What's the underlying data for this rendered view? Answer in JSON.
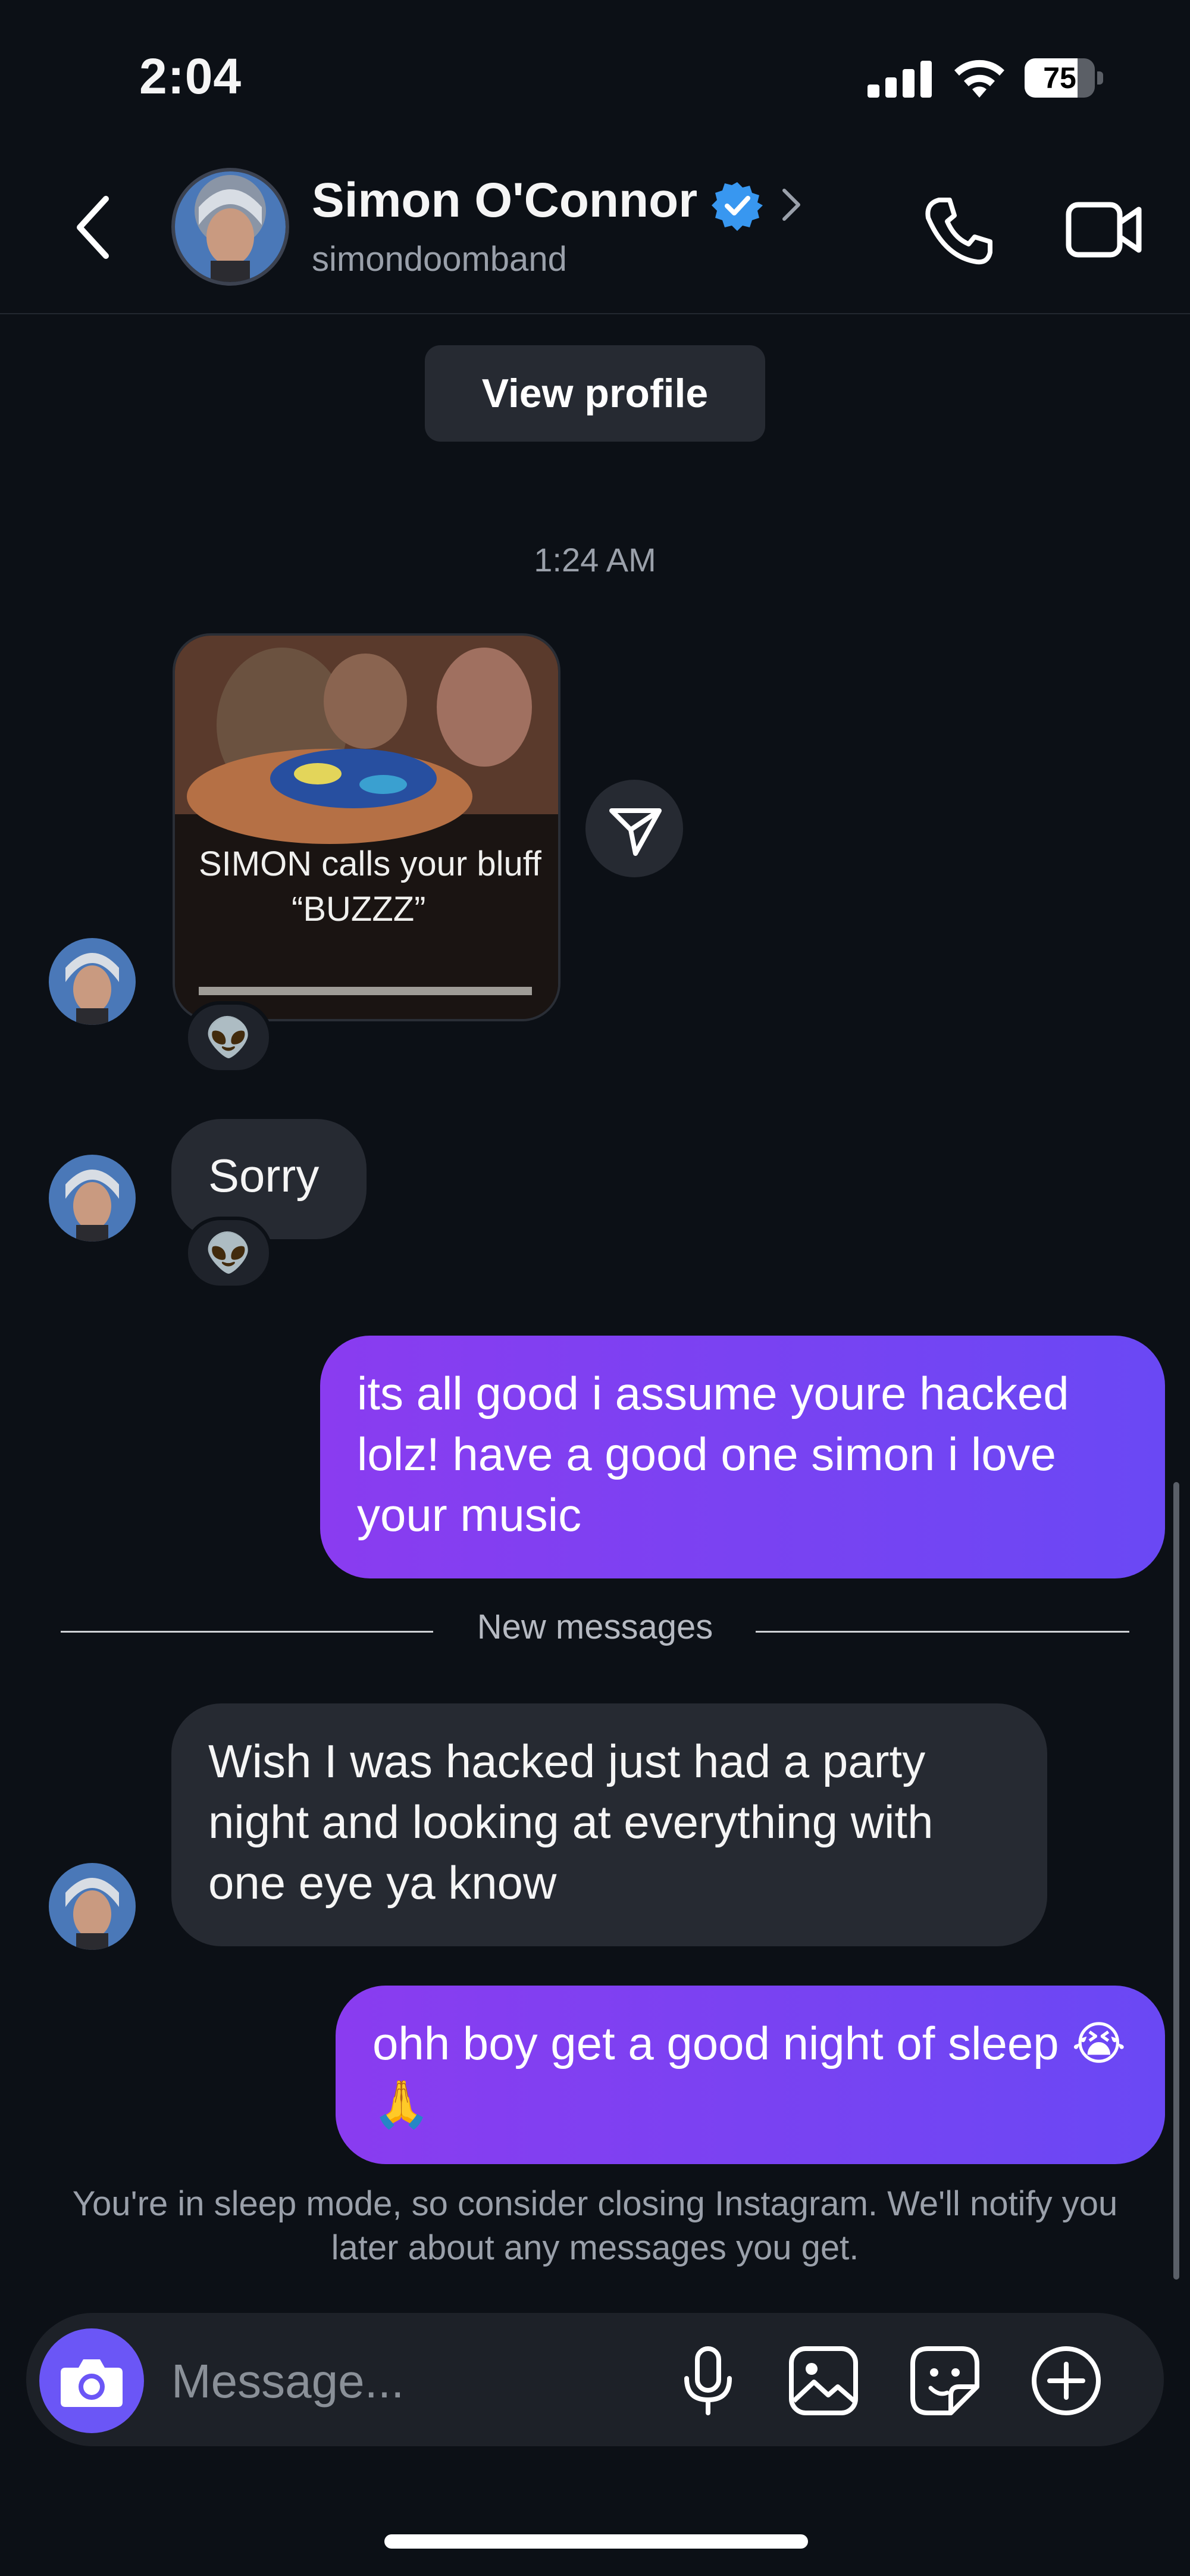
{
  "status_bar": {
    "time": "2:04",
    "battery": "75",
    "battery_level": 0.75
  },
  "header": {
    "name": "Simon O'Connor",
    "username": "simondoomband",
    "icons": [
      "back-chevron-icon",
      "verified-badge-icon",
      "chevron-right-icon",
      "phone-icon",
      "video-camera-icon"
    ]
  },
  "view_profile_label": "View profile",
  "timestamp": "1:24 AM",
  "messages": [
    {
      "id": "photo",
      "from": "them",
      "type": "photo",
      "caption_line1": "SIMON calls your bluff",
      "caption_line2": "“BUZZZ”",
      "reaction": "👽"
    },
    {
      "id": "m1",
      "from": "them",
      "text": "Sorry",
      "reaction": "👽"
    },
    {
      "id": "m2",
      "from": "me",
      "text": "its all good i assume youre hacked lolz! have a good one simon i love your music"
    },
    {
      "id": "m3",
      "from": "them",
      "text": "Wish I was hacked just had a party night and looking at everything with one eye ya know"
    },
    {
      "id": "m4",
      "from": "me",
      "text": "ohh boy get a good night of sleep 😭🙏"
    }
  ],
  "new_messages_label": "New messages",
  "sleep_mode_note": "You're in sleep mode, so consider closing Instagram. We'll notify you later about any messages you get.",
  "composer": {
    "placeholder": "Message...",
    "icons": [
      "camera-icon",
      "microphone-icon",
      "gallery-icon",
      "sticker-icon",
      "plus-icon"
    ]
  },
  "colors": {
    "background": "#0c1016",
    "incoming_bubble": "#262a32",
    "outgoing_start": "#8a3cf0",
    "outgoing_end": "#6a48f4",
    "camera_button": "#6b56f6",
    "verified": "#3897f0"
  }
}
